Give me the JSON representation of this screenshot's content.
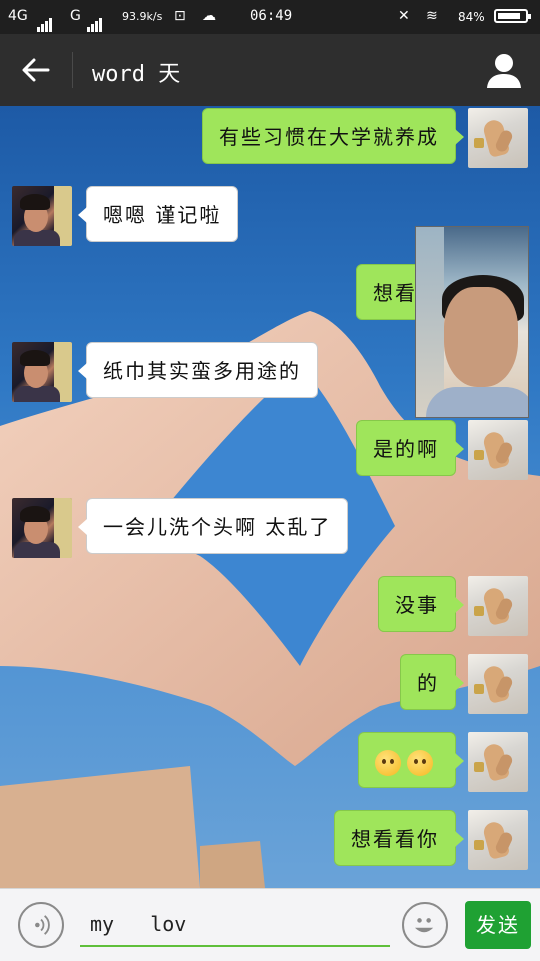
{
  "status_bar": {
    "network_1": "4G",
    "network_2": "G",
    "speed": "93.9k/s",
    "time": "06:49",
    "battery": "84%",
    "battery_level": 0.84
  },
  "header": {
    "title": "word 天"
  },
  "messages": [
    {
      "side": "right",
      "text": "有些习惯在大学就养成"
    },
    {
      "side": "left",
      "text": "嗯嗯 谨记啦"
    },
    {
      "side": "right",
      "text": "想看看"
    },
    {
      "side": "left",
      "text": "纸巾其实蛮多用途的"
    },
    {
      "side": "right",
      "text": "是的啊"
    },
    {
      "side": "left",
      "text": "一会儿洗个头啊 太乱了"
    },
    {
      "side": "right",
      "text": "没事"
    },
    {
      "side": "right",
      "text": "的"
    },
    {
      "side": "right",
      "text": "",
      "emoji_count": 2
    },
    {
      "side": "right",
      "text": "想看看你"
    }
  ],
  "input": {
    "value": "my   lov",
    "send_label": "发送"
  },
  "colors": {
    "header": "#2e2e2e",
    "bubble_right": "#9fe55b",
    "send": "#1fa133"
  }
}
